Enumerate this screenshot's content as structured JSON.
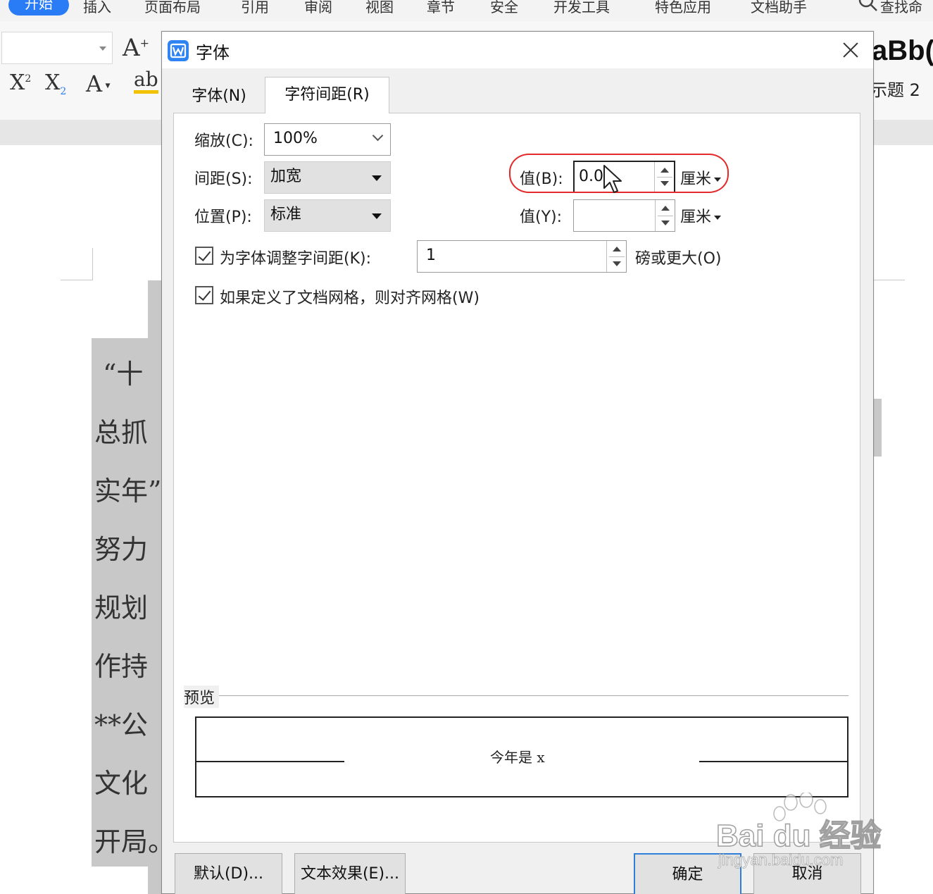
{
  "menubar": {
    "items": [
      "开始",
      "插入",
      "页面布局",
      "引用",
      "审阅",
      "视图",
      "章节",
      "安全",
      "开发工具",
      "特色应用",
      "文档助手"
    ],
    "search_label": "查找命"
  },
  "ribbon": {
    "grow_font_glyph": "A",
    "superscript_glyph": "X",
    "subscript_glyph": "X",
    "font_color_glyph": "A",
    "highlight_glyph": "ab",
    "styles_preview": "aBb(",
    "styles_label": "示题 2"
  },
  "document": {
    "lines": [
      "“十",
      "总抓",
      "实年”",
      "努力",
      "规划",
      "作持",
      "**公",
      "文化",
      "开局。"
    ]
  },
  "dialog": {
    "title": "字体",
    "tabs": [
      {
        "label": "字体(N)",
        "active": false
      },
      {
        "label": "字符间距(R)",
        "active": true
      }
    ],
    "scale": {
      "label": "缩放(C):",
      "value": "100%"
    },
    "spacing": {
      "label": "间距(S):",
      "value": "加宽"
    },
    "position": {
      "label": "位置(P):",
      "value": "标准"
    },
    "value_b": {
      "label": "值(B):",
      "value": "0.0",
      "unit": "厘米"
    },
    "value_y": {
      "label": "值(Y):",
      "value": "",
      "unit": "厘米"
    },
    "kerning": {
      "checked": true,
      "label": "为字体调整字间距(K):",
      "value": "1",
      "suffix": "磅或更大(O)"
    },
    "snap_grid": {
      "checked": true,
      "label": "如果定义了文档网格，则对齐网格(W)"
    },
    "preview": {
      "label": "预览",
      "sample": "今年是 x"
    },
    "buttons": {
      "default": "默认(D)...",
      "text_effects": "文本效果(E)...",
      "ok": "确定",
      "cancel": "取消"
    }
  },
  "watermark": {
    "brand": "Bai du 经验",
    "url": "jingyan.baidu.com"
  },
  "colors": {
    "accent": "#2a7cf6",
    "highlight_ring": "#e22a2a",
    "dialog_bg": "#f0f0f0"
  }
}
